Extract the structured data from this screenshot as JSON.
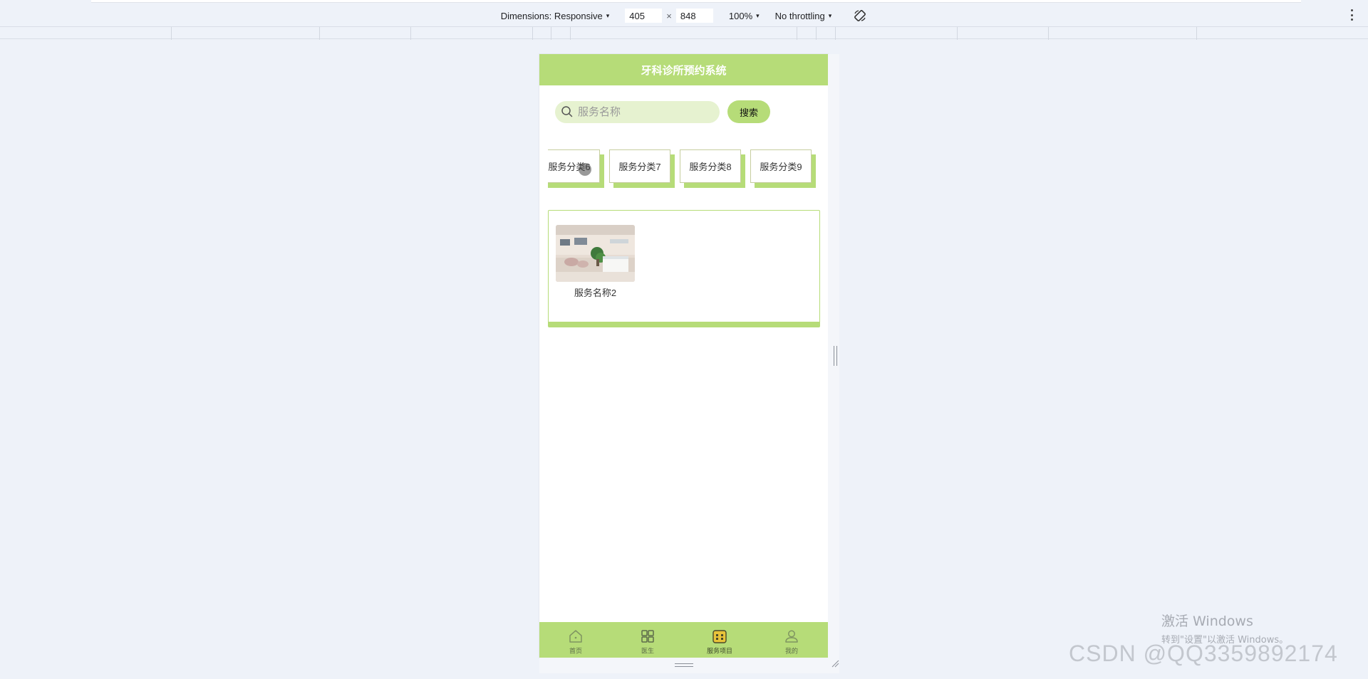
{
  "devtools": {
    "dimensions_label": "Dimensions: Responsive",
    "width_value": "405",
    "times_sign": "×",
    "height_value": "848",
    "zoom_label": "100%",
    "throttling_label": "No throttling",
    "caret": "▾"
  },
  "app": {
    "title": "牙科诊所预约系统",
    "search": {
      "placeholder": "服务名称",
      "button_label": "搜索"
    },
    "categories": [
      {
        "label": "服务分类6"
      },
      {
        "label": "服务分类7"
      },
      {
        "label": "服务分类8"
      },
      {
        "label": "服务分类9"
      }
    ],
    "services": [
      {
        "name": "服务名称2"
      }
    ],
    "tabbar": [
      {
        "label": "首页",
        "icon": "home-icon",
        "active": false
      },
      {
        "label": "医生",
        "icon": "grid-icon",
        "active": false
      },
      {
        "label": "服务项目",
        "icon": "calendar-icon",
        "active": true
      },
      {
        "label": "我的",
        "icon": "user-icon",
        "active": false
      }
    ]
  },
  "colors": {
    "accent_green": "#b6dc78",
    "search_bg": "#e6f2d0",
    "active_icon": "#e8c33a",
    "page_bg": "#eef2f9"
  },
  "watermark": {
    "activate_title": "激活 Windows",
    "activate_sub": "转到\"设置\"以激活 Windows。",
    "csdn": "CSDN @QQ3359892174"
  }
}
